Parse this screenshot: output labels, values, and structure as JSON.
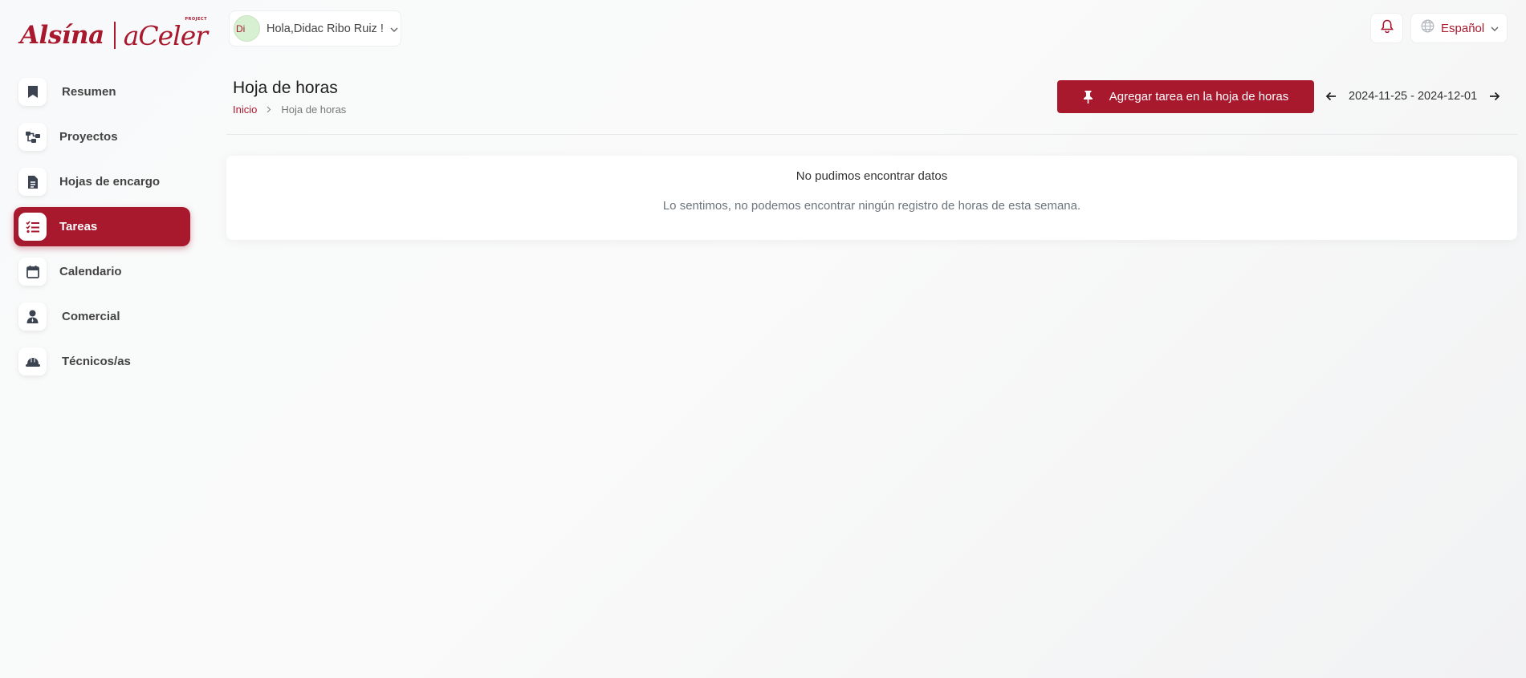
{
  "brand": {
    "logo_left": "Alsína",
    "logo_right": "aCeler",
    "logo_small": "PROJECT",
    "accent": "#a8192e"
  },
  "topbar": {
    "greeting": "Hola,Didac Ribo Ruiz !",
    "avatar_alt": "Di",
    "language": "Español",
    "bell_icon": "bell-icon",
    "globe_icon": "globe-icon"
  },
  "sidebar": {
    "items": [
      {
        "label": "Resumen",
        "icon": "bookmark-icon",
        "active": false
      },
      {
        "label": "Proyectos",
        "icon": "project-diagram-icon",
        "active": false
      },
      {
        "label": "Hojas de encargo",
        "icon": "file-text-icon",
        "active": false
      },
      {
        "label": "Tareas",
        "icon": "tasks-list-icon",
        "active": true
      },
      {
        "label": "Calendario",
        "icon": "calendar-icon",
        "active": false
      },
      {
        "label": "Comercial",
        "icon": "user-tie-icon",
        "active": false
      },
      {
        "label": "Técnicos/as",
        "icon": "hard-hat-icon",
        "active": false
      }
    ]
  },
  "page": {
    "title": "Hoja de horas",
    "breadcrumb": {
      "home": "Inicio",
      "current": "Hoja de horas"
    },
    "add_button": "Agregar tarea en la hoja de horas",
    "week_range": "2024-11-25 - 2024-12-01"
  },
  "empty_state": {
    "title": "No pudimos encontrar datos",
    "message": "Lo sentimos, no podemos encontrar ningún registro de horas de esta semana."
  }
}
